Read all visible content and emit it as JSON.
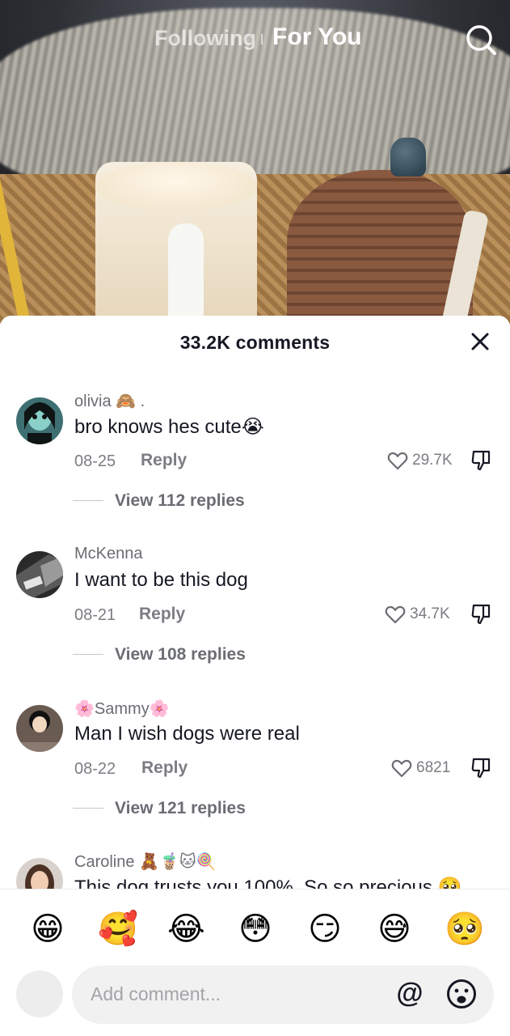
{
  "nav": {
    "following": "Following",
    "for_you": "For You"
  },
  "sheet": {
    "title": "33.2K comments"
  },
  "comments": [
    {
      "username": "olivia",
      "user_emoji": "🙈 .",
      "text": "bro knows hes cute😭",
      "date": "08-25",
      "reply": "Reply",
      "likes": "29.7K",
      "view_replies": "View 112 replies"
    },
    {
      "username": "McKenna",
      "user_emoji": "",
      "text": "I want to be this dog",
      "date": "08-21",
      "reply": "Reply",
      "likes": "34.7K",
      "view_replies": "View 108 replies"
    },
    {
      "username": "Sammy",
      "user_emoji": "🌸",
      "text": "Man I wish dogs were real",
      "date": "08-22",
      "reply": "Reply",
      "likes": "6821",
      "view_replies": "View 121 replies"
    },
    {
      "username": "Caroline",
      "user_emoji": "🧸🧋🐱🍭",
      "text": "This dog trusts you 100%. So so precious 🥺"
    }
  ],
  "emoji_bar": [
    "😁",
    "🥰",
    "😂",
    "😳",
    "😏",
    "😅",
    "🥺"
  ],
  "input": {
    "placeholder": "Add comment...",
    "mention": "@"
  },
  "colors": {
    "text_primary": "#161823",
    "text_secondary": "#7b7d83",
    "sheet_bg": "#ffffff"
  }
}
